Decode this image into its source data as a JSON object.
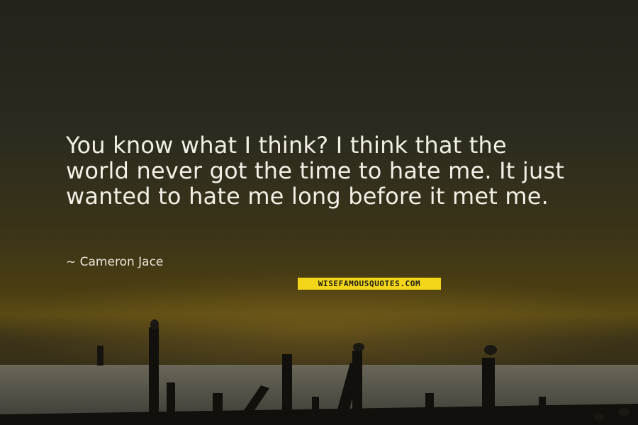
{
  "quote": {
    "text": "You know what I think? I think that the world never got the time to hate me. It just wanted to hate me long before it met me.",
    "author": "~ Cameron Jace"
  },
  "watermark": {
    "brand": "WISEFAMOUSQUOTES.COM",
    "color": "#f3d61a"
  },
  "colors": {
    "sky": "#2b2a1f",
    "horizon": "#5a4a14",
    "text": "#f2efe6"
  }
}
